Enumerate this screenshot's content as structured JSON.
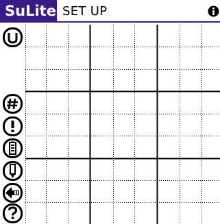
{
  "header": {
    "app_name": "SuLite",
    "screen_title": "SET UP",
    "accent_color": "#3a1a87"
  },
  "toolbar": {
    "buttons": [
      {
        "icon": "u-in-circle-icon",
        "glyph": "U"
      },
      {
        "icon": "hash-icon",
        "glyph": "#"
      },
      {
        "icon": "exclamation-icon",
        "glyph": "!"
      },
      {
        "icon": "battery-icon",
        "glyph": ""
      },
      {
        "icon": "pencil-icon",
        "glyph": ""
      },
      {
        "icon": "back-arrow-icon",
        "glyph": ""
      },
      {
        "icon": "question-icon",
        "glyph": "?"
      }
    ]
  },
  "grid": {
    "rows": 9,
    "columns": 9,
    "cells": [
      [
        "",
        "",
        "",
        "",
        "",
        "",
        "",
        "",
        ""
      ],
      [
        "",
        "",
        "",
        "",
        "",
        "",
        "",
        "",
        ""
      ],
      [
        "",
        "",
        "",
        "",
        "",
        "",
        "",
        "",
        ""
      ],
      [
        "",
        "",
        "",
        "",
        "",
        "",
        "",
        "",
        ""
      ],
      [
        "",
        "",
        "",
        "",
        "",
        "",
        "",
        "",
        ""
      ],
      [
        "",
        "",
        "",
        "",
        "",
        "",
        "",
        "",
        ""
      ],
      [
        "",
        "",
        "",
        "",
        "",
        "",
        "",
        "",
        ""
      ],
      [
        "",
        "",
        "",
        "",
        "",
        "",
        "",
        "",
        ""
      ],
      [
        "",
        "",
        "",
        "",
        "",
        "",
        "",
        "",
        ""
      ]
    ]
  }
}
